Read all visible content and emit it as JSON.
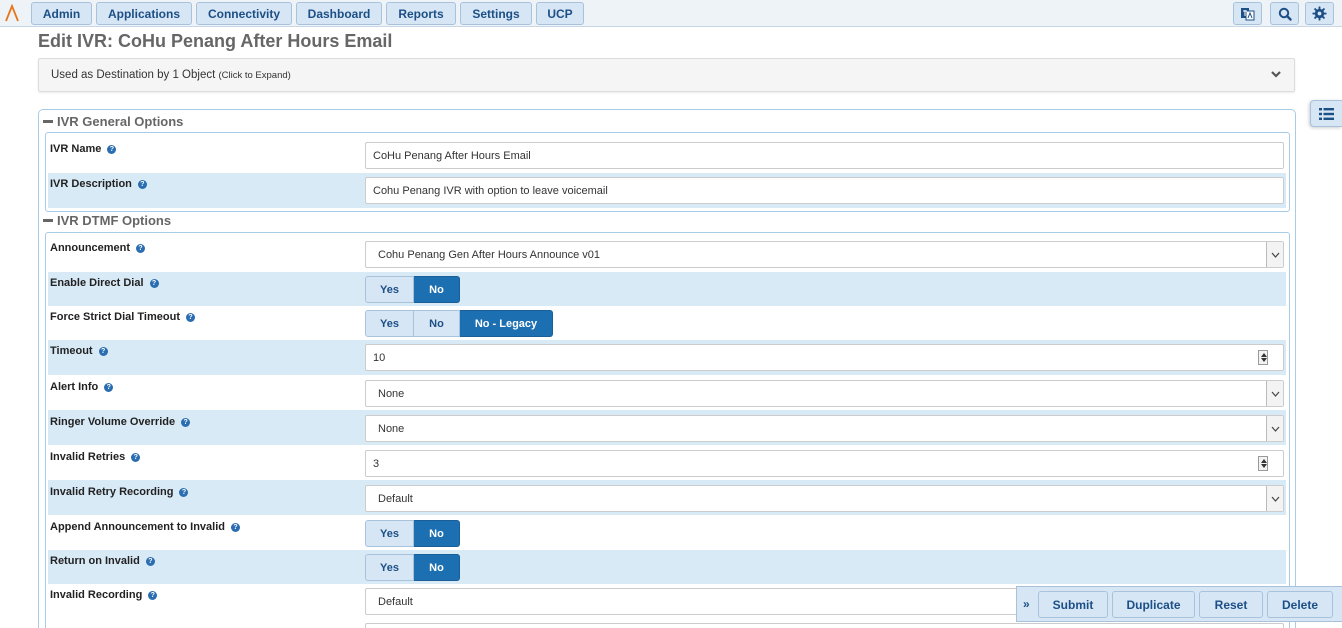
{
  "nav": {
    "items": [
      "Admin",
      "Applications",
      "Connectivity",
      "Dashboard",
      "Reports",
      "Settings",
      "UCP"
    ]
  },
  "page": {
    "title": "Edit IVR: CoHu Penang After Hours Email",
    "destination_text": "Used as Destination by 1 Object",
    "destination_hint": "(Click to Expand)"
  },
  "general": {
    "heading": "IVR General Options",
    "name_label": "IVR Name",
    "name_value": "CoHu Penang After Hours Email",
    "desc_label": "IVR Description",
    "desc_value": "Cohu Penang IVR with option to leave voicemail"
  },
  "dtmf": {
    "heading": "IVR DTMF Options",
    "announcement_label": "Announcement",
    "announcement_value": "Cohu Penang Gen After Hours Announce v01",
    "direct_dial_label": "Enable Direct Dial",
    "strict_timeout_label": "Force Strict Dial Timeout",
    "timeout_label": "Timeout",
    "timeout_value": "10",
    "alert_info_label": "Alert Info",
    "alert_info_value": "None",
    "ringer_label": "Ringer Volume Override",
    "ringer_value": "None",
    "invalid_retries_label": "Invalid Retries",
    "invalid_retries_value": "3",
    "invalid_retry_rec_label": "Invalid Retry Recording",
    "invalid_retry_rec_value": "Default",
    "append_label": "Append Announcement to Invalid",
    "return_label": "Return on Invalid",
    "invalid_rec_label": "Invalid Recording",
    "invalid_rec_value": "Default"
  },
  "toggle": {
    "yes": "Yes",
    "no": "No",
    "legacy": "No - Legacy"
  },
  "help_glyph": "?",
  "actions": {
    "submit": "Submit",
    "duplicate": "Duplicate",
    "reset": "Reset",
    "delete": "Delete",
    "arrow": "»"
  },
  "colors": {
    "accent": "#1c6fb1",
    "nav_bg": "#d7e6f5",
    "row_alt": "#d9eaf7"
  }
}
